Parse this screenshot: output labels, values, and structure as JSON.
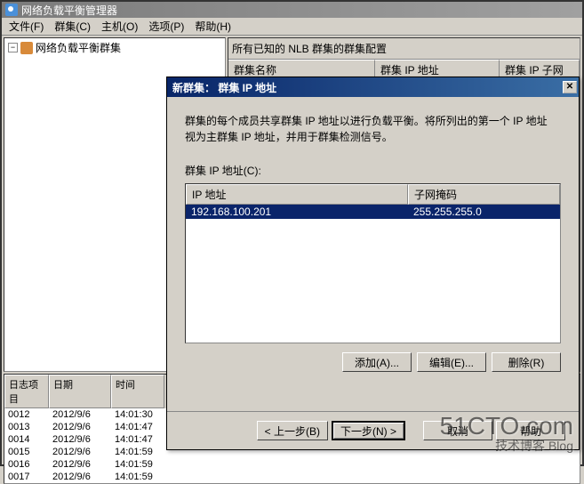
{
  "main_window": {
    "title": "网络负载平衡管理器",
    "menu": {
      "file": "文件(F)",
      "cluster": "群集(C)",
      "host": "主机(O)",
      "options": "选项(P)",
      "help": "帮助(H)"
    },
    "tree": {
      "root": "网络负载平衡群集"
    },
    "right": {
      "caption": "所有已知的 NLB 群集的群集配置",
      "col_name": "群集名称",
      "col_ip": "群集 IP 地址",
      "col_subnet": "群集 IP 子网"
    },
    "log": {
      "col_entry": "日志项目",
      "col_date": "日期",
      "col_time": "时间",
      "rows": [
        {
          "id": "0012",
          "date": "2012/9/6",
          "time": "14:01:30"
        },
        {
          "id": "0013",
          "date": "2012/9/6",
          "time": "14:01:47"
        },
        {
          "id": "0014",
          "date": "2012/9/6",
          "time": "14:01:47"
        },
        {
          "id": "0015",
          "date": "2012/9/6",
          "time": "14:01:59"
        },
        {
          "id": "0016",
          "date": "2012/9/6",
          "time": "14:01:59"
        },
        {
          "id": "0017",
          "date": "2012/9/6",
          "time": "14:01:59"
        }
      ]
    }
  },
  "dialog": {
    "title": "新群集：  群集 IP 地址",
    "desc_line1": "群集的每个成员共享群集 IP 地址以进行负载平衡。将所列出的第一个 IP 地址",
    "desc_line2": "视为主群集 IP 地址，并用于群集检测信号。",
    "ip_label": "群集 IP 地址(C):",
    "col_ip": "IP 地址",
    "col_mask": "子网掩码",
    "rows": [
      {
        "ip": "192.168.100.201",
        "mask": "255.255.255.0"
      }
    ],
    "btn_add": "添加(A)...",
    "btn_edit": "编辑(E)...",
    "btn_remove": "删除(R)",
    "btn_back": "< 上一步(B)",
    "btn_next": "下一步(N) >",
    "btn_cancel": "取消",
    "btn_help": "帮助"
  },
  "watermark": {
    "main": "51CTO.com",
    "sub": "技术博客      Blog"
  }
}
